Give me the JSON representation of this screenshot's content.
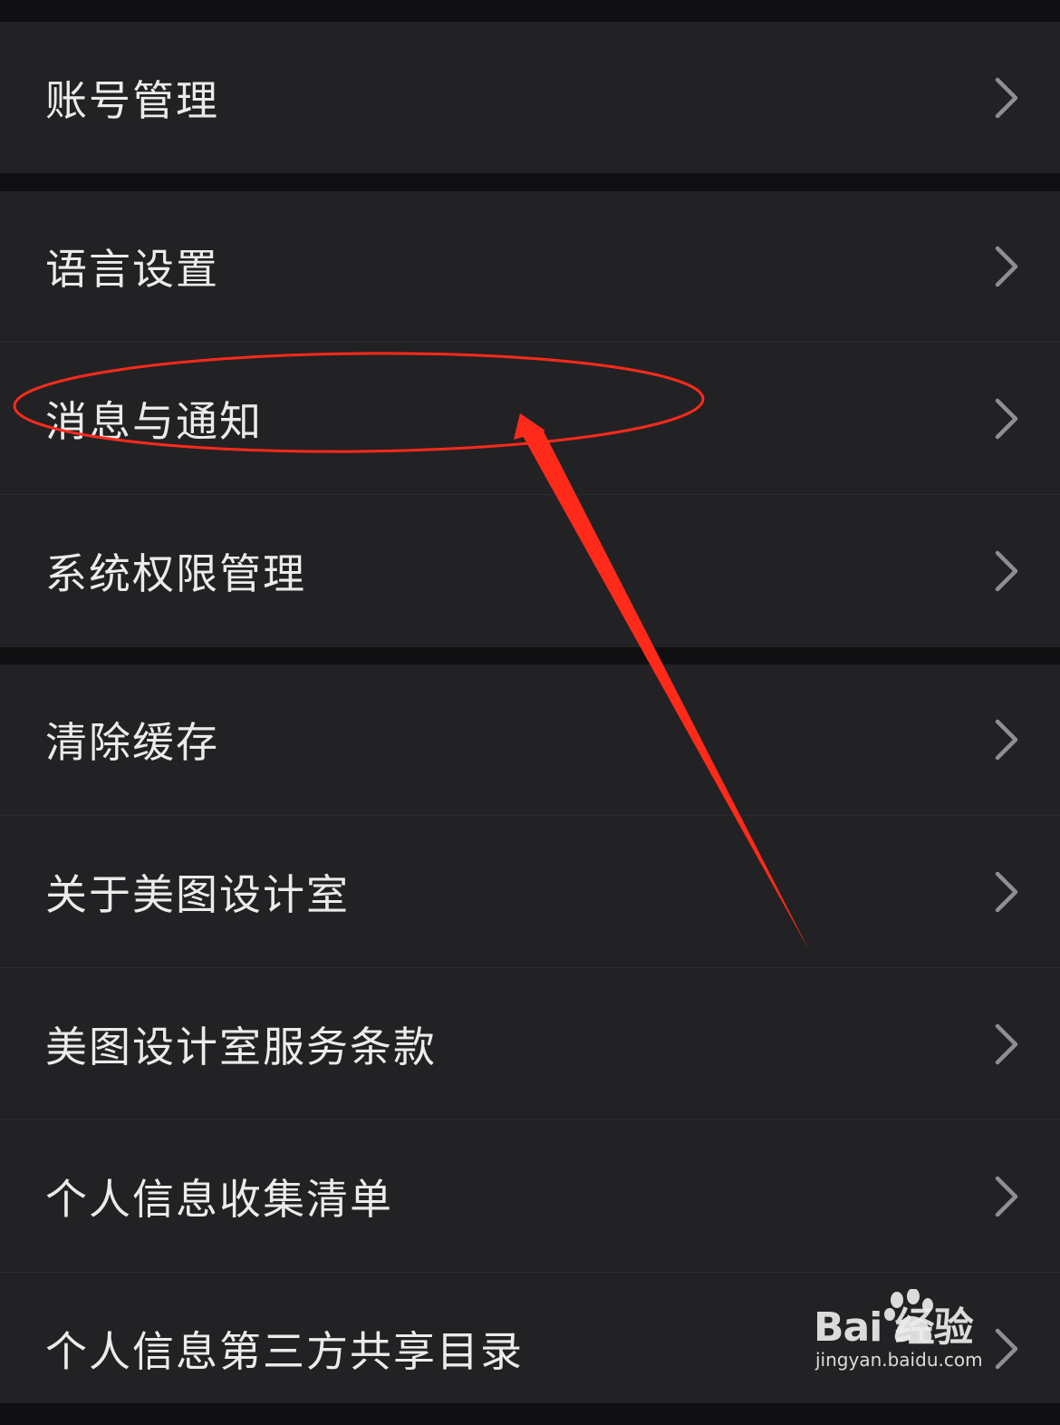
{
  "settings": {
    "group1": [
      {
        "label": "账号管理"
      }
    ],
    "group2": [
      {
        "label": "语言设置"
      },
      {
        "label": "消息与通知"
      },
      {
        "label": "系统权限管理"
      }
    ],
    "group3": [
      {
        "label": "清除缓存"
      },
      {
        "label": "关于美图设计室"
      },
      {
        "label": "美图设计室服务条款"
      },
      {
        "label": "个人信息收集清单"
      },
      {
        "label": "个人信息第三方共享目录"
      }
    ]
  },
  "icons": {
    "row_chevron": "chevron-right-icon"
  },
  "colors": {
    "background": "#0f0f11",
    "row_background": "#222225",
    "text": "#ebebeb",
    "chevron": "#8e8e93",
    "annotation": "#ff2a1a"
  },
  "watermark": {
    "brand": "Bai 经验",
    "url": "jingyan.baidu.com"
  }
}
